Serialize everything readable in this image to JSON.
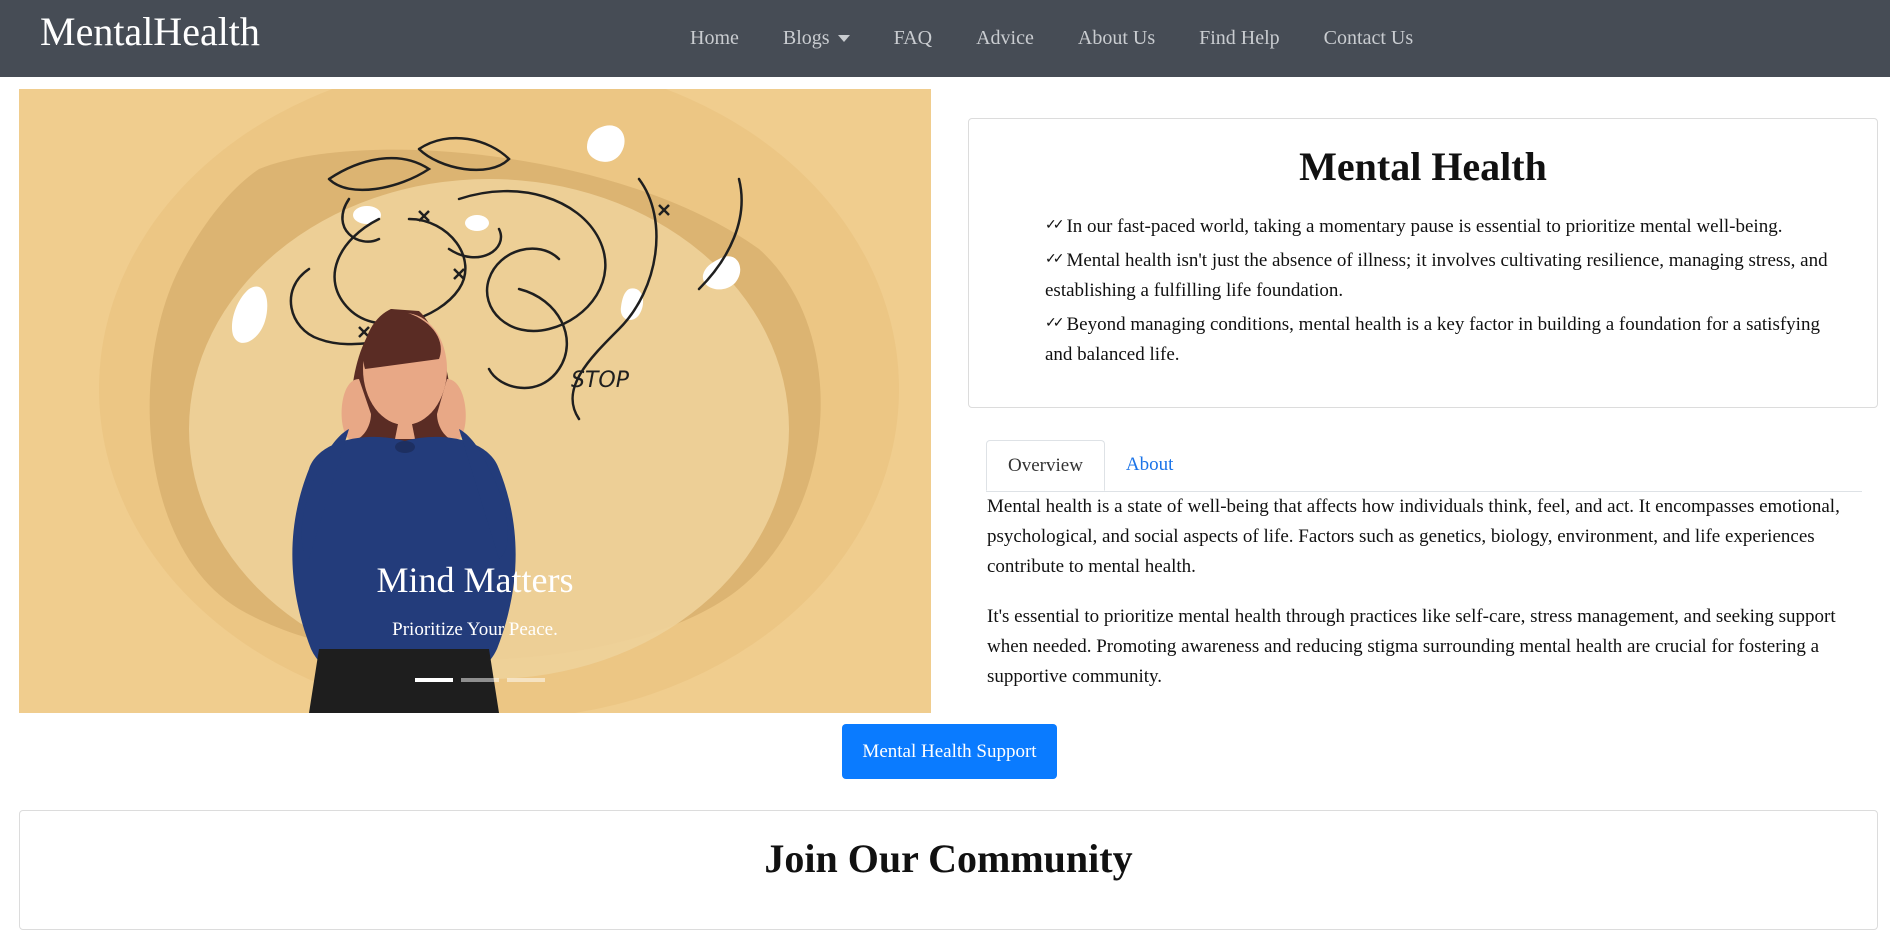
{
  "navbar": {
    "brand": "MentalHealth",
    "links": [
      "Home",
      "Blogs",
      "FAQ",
      "Advice",
      "About Us",
      "Find Help",
      "Contact Us"
    ]
  },
  "carousel": {
    "title": "Mind Matters",
    "subtitle": "Prioritize Your Peace.",
    "illustration_text": "STOP",
    "slide_count": 3,
    "active_slide": 1
  },
  "card": {
    "title": "Mental Health",
    "points": [
      "In our fast-paced world, taking a momentary pause is essential to prioritize mental well-being.",
      "Mental health isn't just the absence of illness; it involves cultivating resilience, managing stress, and establishing a fulfilling life foundation.",
      "Beyond managing conditions, mental health is a key factor in building a foundation for a satisfying and balanced life."
    ]
  },
  "tabs": {
    "items": [
      "Overview",
      "About"
    ],
    "active": "Overview"
  },
  "overview": {
    "paragraphs": [
      "Mental health is a state of well-being that affects how individuals think, feel, and act. It encompasses emotional, psychological, and social aspects of life. Factors such as genetics, biology, environment, and life experiences contribute to mental health.",
      "It's essential to prioritize mental health through practices like self-care, stress management, and seeking support when needed. Promoting awareness and reducing stigma surrounding mental health are crucial for fostering a supportive community."
    ]
  },
  "support_button": "Mental Health Support",
  "community": {
    "title": "Join Our Community"
  },
  "colors": {
    "navbar": "#464c55",
    "accent_blue": "#0a7bff",
    "carousel_bg": "#f0cd8e",
    "sweater": "#233c7b"
  }
}
